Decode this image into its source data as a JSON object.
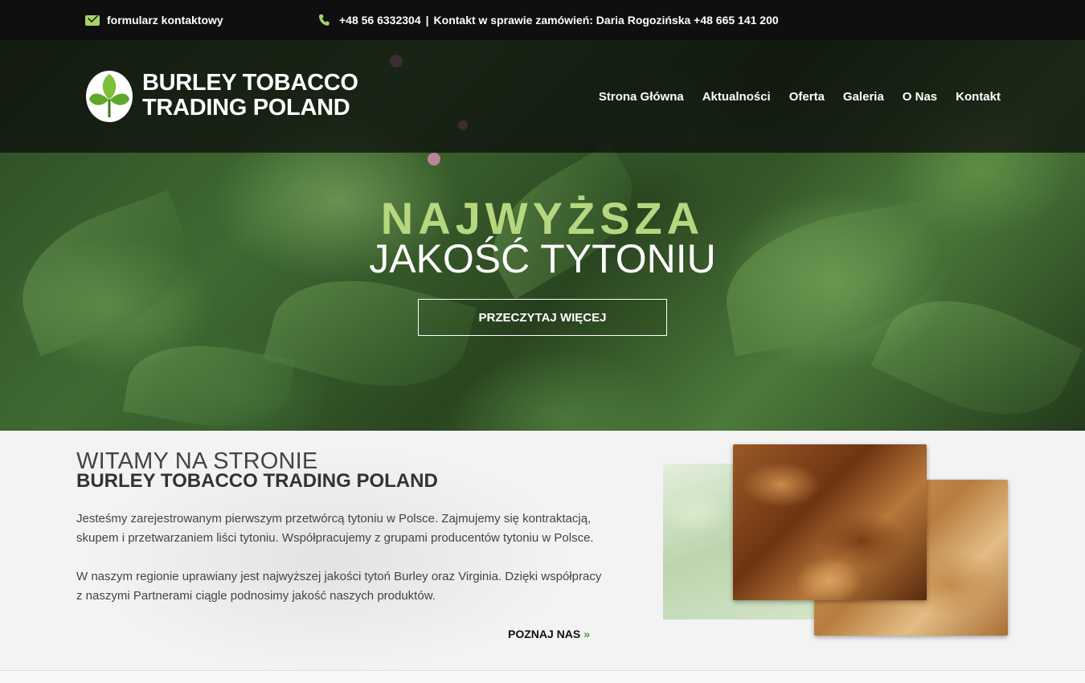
{
  "topbar": {
    "contact_form": "formularz kontaktowy",
    "phone": "+48 56 6332304",
    "separator": "|",
    "orders": "Kontakt w sprawie zamówień: Daria Rogozińska +48 665 141 200",
    "icons": [
      "envelope-icon",
      "phone-icon"
    ],
    "icon_color": "#a7d26a"
  },
  "logo": {
    "line1": "BURLEY TOBACCO",
    "line2": "TRADING POLAND",
    "icon": "leaf-logo-icon"
  },
  "nav": {
    "items": [
      "Strona Główna",
      "Aktualności",
      "Oferta",
      "Galeria",
      "O Nas",
      "Kontakt"
    ]
  },
  "hero": {
    "title_line1": "NAJWYŻSZA",
    "title_line2": "JAKOŚĆ TYTONIU",
    "button": "PRZECZYTAJ WIĘCEJ",
    "accent_color": "#b6d77f"
  },
  "welcome": {
    "title_line1": "WITAMY NA STRONIE",
    "title_line2": "BURLEY TOBACCO TRADING POLAND",
    "paragraph1": "Jesteśmy zarejestrowanym pierwszym przetwórcą tytoniu w Polsce. Zajmujemy się kontraktacją, skupem i przetwarzaniem liści tytoniu. Współpracujemy z grupami producentów tytoniu w Polsce.",
    "paragraph2": "W naszym regionie uprawiany jest najwyższej jakości tytoń Burley oraz Virginia. Dzięki współpracy z naszymi Partnerami ciągle podnosimy jakość naszych produktów.",
    "more_link": "POZNAJ NAS",
    "more_icon": "double-chevron-right-icon"
  }
}
